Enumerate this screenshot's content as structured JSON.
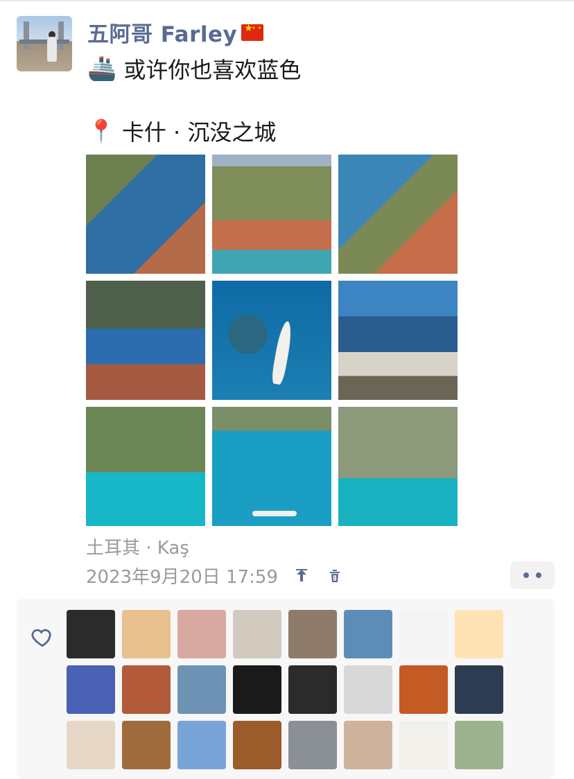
{
  "post": {
    "username": "五阿哥 Farley",
    "line1_text": "或许你也喜欢蓝色",
    "line2_text": "卡什 · 沉没之城",
    "location": "土耳其 · Kaş",
    "timestamp": "2023年9月20日 17:59",
    "icons": {
      "ship": "🚢",
      "location_pin": "📍",
      "flag": "china-flag-icon",
      "upload": "upload-icon",
      "delete": "trash-icon",
      "more": "more-options-icon",
      "like": "heart-icon"
    }
  },
  "photos": [
    {
      "name": "photo-1"
    },
    {
      "name": "photo-2"
    },
    {
      "name": "photo-3"
    },
    {
      "name": "photo-4"
    },
    {
      "name": "photo-5"
    },
    {
      "name": "photo-6"
    },
    {
      "name": "photo-7"
    },
    {
      "name": "photo-8"
    },
    {
      "name": "photo-9"
    }
  ],
  "likes": {
    "avatars": [
      {
        "color": "#2b2b2b"
      },
      {
        "color": "#e8c18f"
      },
      {
        "color": "#d7a9a0"
      },
      {
        "color": "#d2c9bf"
      },
      {
        "color": "#8f7b6a"
      },
      {
        "color": "#5d8db7"
      },
      {
        "color": "#f4f4f4"
      },
      {
        "color": "#ffe3b4"
      },
      {
        "color": "#4a61b4"
      },
      {
        "color": "#b35a3a"
      },
      {
        "color": "#6f93b4"
      },
      {
        "color": "#1a1a1a"
      },
      {
        "color": "#2b2b2b"
      },
      {
        "color": "#d8d8d8"
      },
      {
        "color": "#c45a24"
      },
      {
        "color": "#2e3c52"
      },
      {
        "color": "#e7d7c6"
      },
      {
        "color": "#a06b3c"
      },
      {
        "color": "#79a4d7"
      },
      {
        "color": "#9b5b2b"
      },
      {
        "color": "#8b8f96"
      },
      {
        "color": "#cfb29b"
      },
      {
        "color": "#f2f0ea"
      },
      {
        "color": "#9db28e"
      }
    ]
  }
}
